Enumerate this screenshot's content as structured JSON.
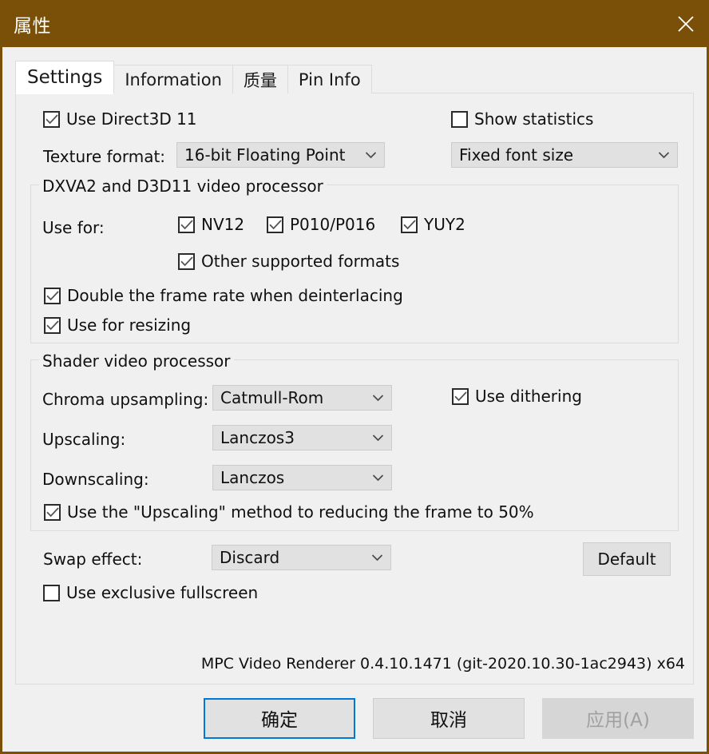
{
  "window": {
    "title": "属性",
    "close_icon": "close-icon",
    "accent_color": "#7a4f08"
  },
  "tabs": [
    {
      "label": "Settings",
      "active": true
    },
    {
      "label": "Information",
      "active": false
    },
    {
      "label": "质量",
      "active": false
    },
    {
      "label": "Pin Info",
      "active": false
    }
  ],
  "settings": {
    "use_direct3d11": {
      "label": "Use Direct3D 11",
      "checked": true
    },
    "texture_format": {
      "label": "Texture format:",
      "value": "16-bit Floating Point"
    },
    "show_statistics": {
      "label": "Show statistics",
      "checked": false
    },
    "font_size": {
      "value": "Fixed font size"
    },
    "dxva_group": {
      "title": "DXVA2 and D3D11 video processor",
      "use_for_label": "Use for:",
      "formats": [
        {
          "label": "NV12",
          "checked": true
        },
        {
          "label": "P010/P016",
          "checked": true
        },
        {
          "label": "YUY2",
          "checked": true
        }
      ],
      "other_formats": {
        "label": "Other supported formats",
        "checked": true
      },
      "double_frame_rate": {
        "label": "Double the frame rate when deinterlacing",
        "checked": true
      },
      "use_for_resizing": {
        "label": "Use for resizing",
        "checked": true
      }
    },
    "shader_group": {
      "title": "Shader video processor",
      "chroma_upsampling": {
        "label": "Chroma upsampling:",
        "value": "Catmull-Rom"
      },
      "upscaling": {
        "label": "Upscaling:",
        "value": "Lanczos3"
      },
      "downscaling": {
        "label": "Downscaling:",
        "value": "Lanczos"
      },
      "use_dithering": {
        "label": "Use dithering",
        "checked": true
      },
      "use_upscaling_reduce": {
        "label": "Use the \"Upscaling\" method to reducing the frame to 50%",
        "checked": true
      }
    },
    "swap_effect": {
      "label": "Swap effect:",
      "value": "Discard"
    },
    "default_button": {
      "label": "Default"
    },
    "use_exclusive_fullscreen": {
      "label": "Use exclusive fullscreen",
      "checked": false
    },
    "version_line": "MPC Video Renderer 0.4.10.1471 (git-2020.10.30-1ac2943) x64"
  },
  "footer": {
    "ok": "确定",
    "cancel": "取消",
    "apply": "应用(A)"
  }
}
